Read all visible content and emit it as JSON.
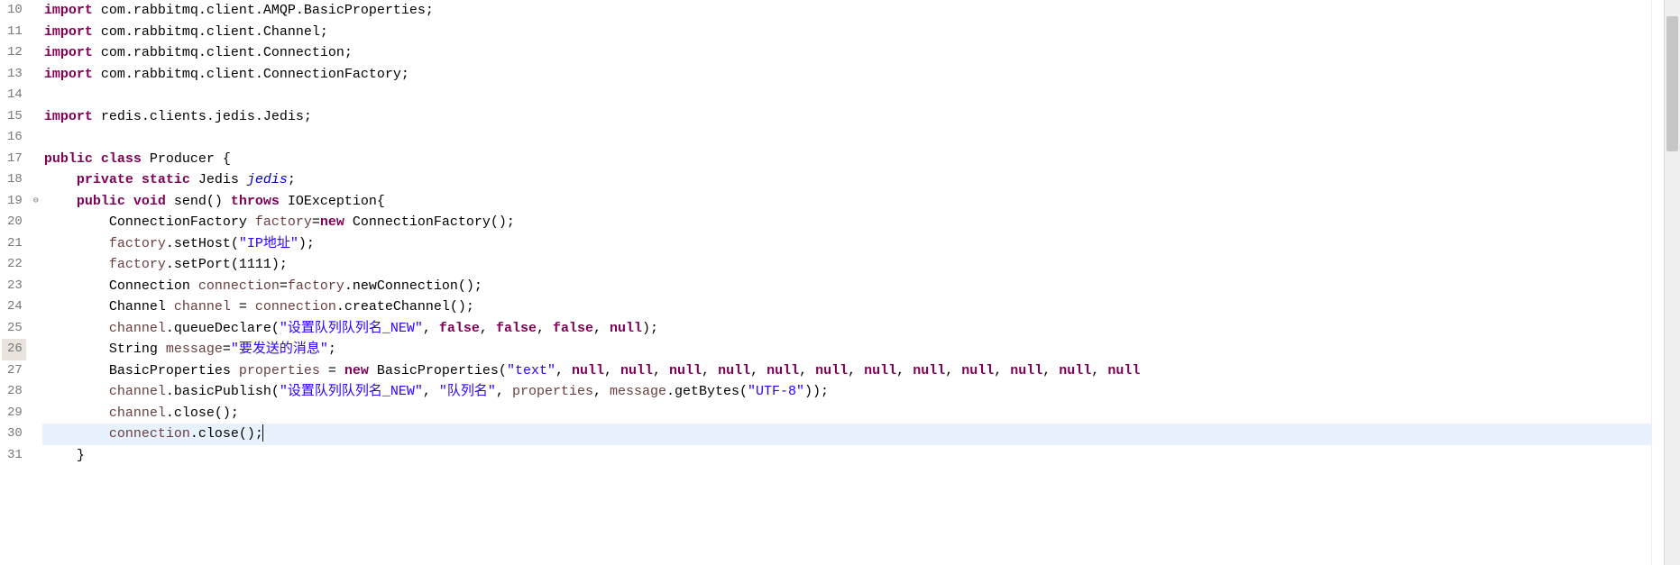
{
  "lines": [
    {
      "num": "10",
      "tokens": [
        {
          "c": "kw",
          "t": "import"
        },
        {
          "c": "plain",
          "t": " com.rabbitmq.client.AMQP.BasicProperties;"
        }
      ]
    },
    {
      "num": "11",
      "tokens": [
        {
          "c": "kw",
          "t": "import"
        },
        {
          "c": "plain",
          "t": " com.rabbitmq.client.Channel;"
        }
      ]
    },
    {
      "num": "12",
      "tokens": [
        {
          "c": "kw",
          "t": "import"
        },
        {
          "c": "plain",
          "t": " com.rabbitmq.client.Connection;"
        }
      ]
    },
    {
      "num": "13",
      "tokens": [
        {
          "c": "kw",
          "t": "import"
        },
        {
          "c": "plain",
          "t": " com.rabbitmq.client.ConnectionFactory;"
        }
      ]
    },
    {
      "num": "14",
      "tokens": []
    },
    {
      "num": "15",
      "tokens": [
        {
          "c": "kw",
          "t": "import"
        },
        {
          "c": "plain",
          "t": " redis.clients.jedis.Jedis;"
        }
      ]
    },
    {
      "num": "16",
      "tokens": []
    },
    {
      "num": "17",
      "tokens": [
        {
          "c": "kw",
          "t": "public"
        },
        {
          "c": "plain",
          "t": " "
        },
        {
          "c": "kw",
          "t": "class"
        },
        {
          "c": "plain",
          "t": " Producer {"
        }
      ]
    },
    {
      "num": "18",
      "tokens": [
        {
          "c": "plain",
          "t": "    "
        },
        {
          "c": "kw",
          "t": "private"
        },
        {
          "c": "plain",
          "t": " "
        },
        {
          "c": "kw",
          "t": "static"
        },
        {
          "c": "plain",
          "t": " Jedis "
        },
        {
          "c": "ital",
          "t": "jedis"
        },
        {
          "c": "plain",
          "t": ";"
        }
      ]
    },
    {
      "num": "19",
      "annot": "⊖",
      "tokens": [
        {
          "c": "plain",
          "t": "    "
        },
        {
          "c": "kw",
          "t": "public"
        },
        {
          "c": "plain",
          "t": " "
        },
        {
          "c": "kw",
          "t": "void"
        },
        {
          "c": "plain",
          "t": " send() "
        },
        {
          "c": "kw",
          "t": "throws"
        },
        {
          "c": "plain",
          "t": " IOException{"
        }
      ]
    },
    {
      "num": "20",
      "tokens": [
        {
          "c": "plain",
          "t": "        ConnectionFactory "
        },
        {
          "c": "ident",
          "t": "factory"
        },
        {
          "c": "plain",
          "t": "="
        },
        {
          "c": "kw",
          "t": "new"
        },
        {
          "c": "plain",
          "t": " ConnectionFactory();"
        }
      ]
    },
    {
      "num": "21",
      "tokens": [
        {
          "c": "plain",
          "t": "        "
        },
        {
          "c": "ident",
          "t": "factory"
        },
        {
          "c": "plain",
          "t": ".setHost("
        },
        {
          "c": "str",
          "t": "\"IP地址\""
        },
        {
          "c": "plain",
          "t": ");"
        }
      ]
    },
    {
      "num": "22",
      "tokens": [
        {
          "c": "plain",
          "t": "        "
        },
        {
          "c": "ident",
          "t": "factory"
        },
        {
          "c": "plain",
          "t": ".setPort(1111);"
        }
      ]
    },
    {
      "num": "23",
      "tokens": [
        {
          "c": "plain",
          "t": "        Connection "
        },
        {
          "c": "ident",
          "t": "connection"
        },
        {
          "c": "plain",
          "t": "="
        },
        {
          "c": "ident",
          "t": "factory"
        },
        {
          "c": "plain",
          "t": ".newConnection();"
        }
      ]
    },
    {
      "num": "24",
      "tokens": [
        {
          "c": "plain",
          "t": "        Channel "
        },
        {
          "c": "ident",
          "t": "channel"
        },
        {
          "c": "plain",
          "t": " = "
        },
        {
          "c": "ident",
          "t": "connection"
        },
        {
          "c": "plain",
          "t": ".createChannel();"
        }
      ]
    },
    {
      "num": "25",
      "tokens": [
        {
          "c": "plain",
          "t": "        "
        },
        {
          "c": "ident",
          "t": "channel"
        },
        {
          "c": "plain",
          "t": ".queueDeclare("
        },
        {
          "c": "str",
          "t": "\"设置队列队列名_NEW\""
        },
        {
          "c": "plain",
          "t": ", "
        },
        {
          "c": "kw",
          "t": "false"
        },
        {
          "c": "plain",
          "t": ", "
        },
        {
          "c": "kw",
          "t": "false"
        },
        {
          "c": "plain",
          "t": ", "
        },
        {
          "c": "kw",
          "t": "false"
        },
        {
          "c": "plain",
          "t": ", "
        },
        {
          "c": "kw",
          "t": "null"
        },
        {
          "c": "plain",
          "t": ");"
        }
      ]
    },
    {
      "num": "26",
      "hl": true,
      "tokens": [
        {
          "c": "plain",
          "t": "        String "
        },
        {
          "c": "ident",
          "t": "message"
        },
        {
          "c": "plain",
          "t": "="
        },
        {
          "c": "str",
          "t": "\"要发送的消息\""
        },
        {
          "c": "plain",
          "t": ";"
        }
      ]
    },
    {
      "num": "27",
      "tokens": [
        {
          "c": "plain",
          "t": "        BasicProperties "
        },
        {
          "c": "ident",
          "t": "properties"
        },
        {
          "c": "plain",
          "t": " = "
        },
        {
          "c": "kw",
          "t": "new"
        },
        {
          "c": "plain",
          "t": " BasicProperties("
        },
        {
          "c": "str",
          "t": "\"text\""
        },
        {
          "c": "plain",
          "t": ", "
        },
        {
          "c": "kw",
          "t": "null"
        },
        {
          "c": "plain",
          "t": ", "
        },
        {
          "c": "kw",
          "t": "null"
        },
        {
          "c": "plain",
          "t": ", "
        },
        {
          "c": "kw",
          "t": "null"
        },
        {
          "c": "plain",
          "t": ", "
        },
        {
          "c": "kw",
          "t": "null"
        },
        {
          "c": "plain",
          "t": ", "
        },
        {
          "c": "kw",
          "t": "null"
        },
        {
          "c": "plain",
          "t": ", "
        },
        {
          "c": "kw",
          "t": "null"
        },
        {
          "c": "plain",
          "t": ", "
        },
        {
          "c": "kw",
          "t": "null"
        },
        {
          "c": "plain",
          "t": ", "
        },
        {
          "c": "kw",
          "t": "null"
        },
        {
          "c": "plain",
          "t": ", "
        },
        {
          "c": "kw",
          "t": "null"
        },
        {
          "c": "plain",
          "t": ", "
        },
        {
          "c": "kw",
          "t": "null"
        },
        {
          "c": "plain",
          "t": ", "
        },
        {
          "c": "kw",
          "t": "null"
        },
        {
          "c": "plain",
          "t": ", "
        },
        {
          "c": "kw",
          "t": "null"
        }
      ]
    },
    {
      "num": "28",
      "tokens": [
        {
          "c": "plain",
          "t": "        "
        },
        {
          "c": "ident",
          "t": "channel"
        },
        {
          "c": "plain",
          "t": ".basicPublish("
        },
        {
          "c": "str",
          "t": "\"设置队列队列名_NEW\""
        },
        {
          "c": "plain",
          "t": ", "
        },
        {
          "c": "str",
          "t": "\"队列名\""
        },
        {
          "c": "plain",
          "t": ", "
        },
        {
          "c": "ident",
          "t": "properties"
        },
        {
          "c": "plain",
          "t": ", "
        },
        {
          "c": "ident",
          "t": "message"
        },
        {
          "c": "plain",
          "t": ".getBytes("
        },
        {
          "c": "str",
          "t": "\"UTF-8\""
        },
        {
          "c": "plain",
          "t": "));"
        }
      ]
    },
    {
      "num": "29",
      "tokens": [
        {
          "c": "plain",
          "t": "        "
        },
        {
          "c": "ident",
          "t": "channel"
        },
        {
          "c": "plain",
          "t": ".close();"
        }
      ]
    },
    {
      "num": "30",
      "current": true,
      "caret": true,
      "tokens": [
        {
          "c": "plain",
          "t": "        "
        },
        {
          "c": "ident",
          "t": "connection"
        },
        {
          "c": "plain",
          "t": ".close();"
        }
      ]
    },
    {
      "num": "31",
      "tokens": [
        {
          "c": "plain",
          "t": "    }"
        }
      ]
    }
  ]
}
